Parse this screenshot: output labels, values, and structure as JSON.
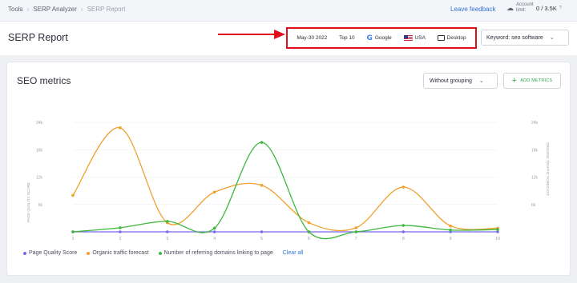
{
  "breadcrumbs": [
    "Tools",
    "SERP Analyzer",
    "SERP Report"
  ],
  "leave_feedback": "Leave feedback",
  "account": {
    "label": "Account limit:",
    "value": "0 / 3.5K"
  },
  "page_title": "SERP Report",
  "filters": {
    "date": "May-30 2022",
    "top": "Top 10",
    "engine": "Google",
    "country": "USA",
    "device": "Desktop"
  },
  "keyword": "Keyword: seo software",
  "panel": {
    "title": "SEO metrics",
    "grouping": "Without grouping",
    "add_metrics": "ADD METRICS"
  },
  "chart_data": {
    "type": "line",
    "x": [
      1,
      2,
      3,
      4,
      5,
      6,
      7,
      8,
      9,
      10
    ],
    "y_ticks_left": [
      "24k",
      "18k",
      "12k",
      "6k"
    ],
    "y_ticks_right": [
      "24k",
      "18k",
      "12k",
      "6k"
    ],
    "ylabel_left": "PAGE QUALITY SCORE",
    "ylabel_right": "ORGANIC TRAFFIC FORECAST",
    "ylim": [
      0,
      24000
    ],
    "series": [
      {
        "name": "Page Quality Score",
        "color": "#7b68ee",
        "values": [
          0,
          0,
          0,
          0,
          0,
          0,
          0,
          0,
          0,
          0
        ]
      },
      {
        "name": "Organic traffic forecast",
        "color": "#f0a02d",
        "values": [
          8000,
          22800,
          2000,
          8700,
          10200,
          2000,
          900,
          9800,
          1300,
          800
        ]
      },
      {
        "name": "Number of referring domains linking to page",
        "color": "#3cb83c",
        "values": null,
        "raw_values": [
          0,
          900,
          2300,
          800,
          19600,
          0,
          0,
          1400,
          400,
          500
        ]
      }
    ]
  },
  "legend": {
    "clear": "Clear all"
  }
}
